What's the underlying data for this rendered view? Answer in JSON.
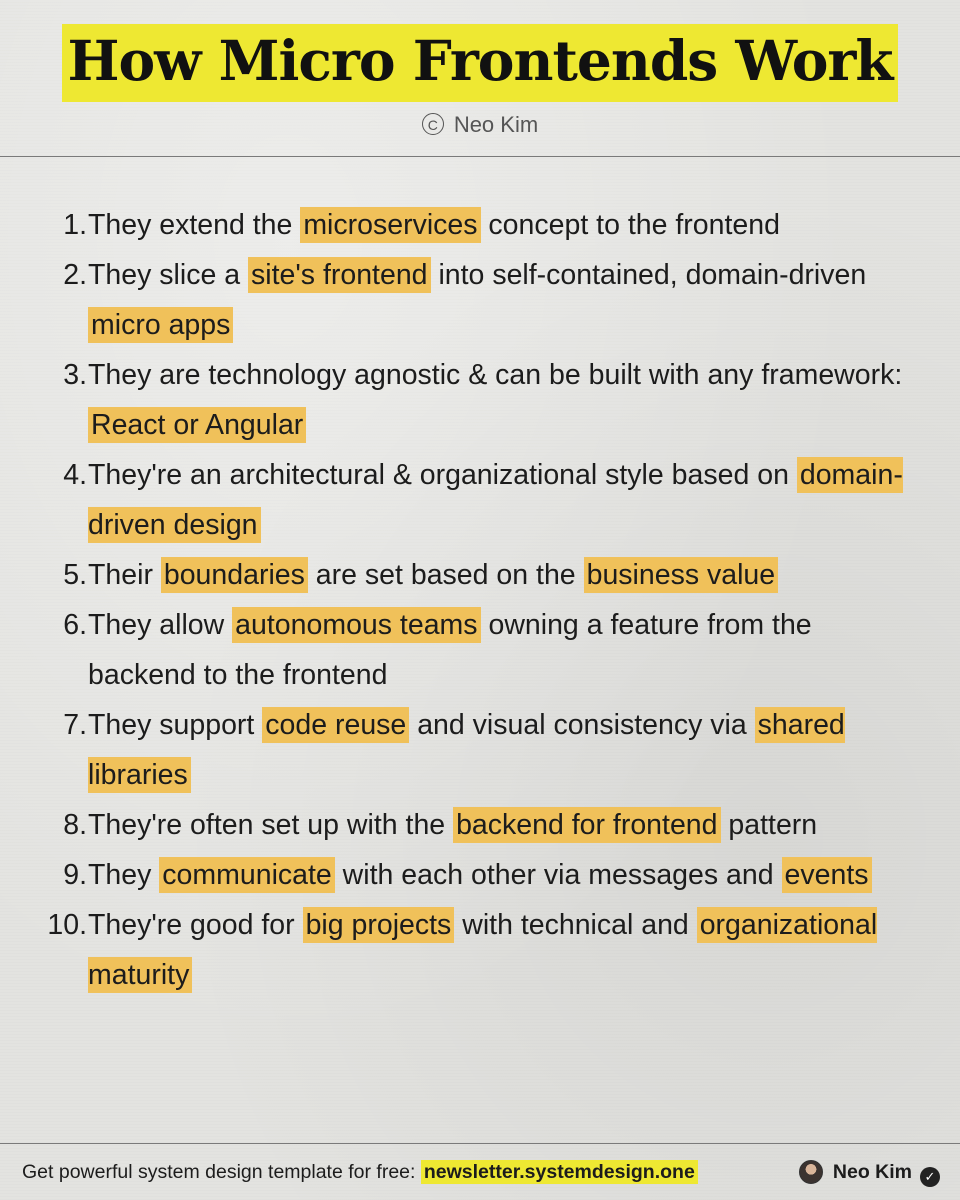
{
  "header": {
    "title": "How Micro Frontends Work",
    "copyright_symbol": "C",
    "author": "Neo Kim"
  },
  "items": [
    {
      "number": "1.",
      "segments": [
        {
          "text": "They extend the "
        },
        {
          "text": "microservices",
          "hl": true
        },
        {
          "text": " concept to the frontend"
        }
      ]
    },
    {
      "number": "2.",
      "segments": [
        {
          "text": "They slice a "
        },
        {
          "text": "site's frontend",
          "hl": true
        },
        {
          "text": " into self-contained, domain-driven "
        },
        {
          "text": "micro apps",
          "hl": true
        }
      ]
    },
    {
      "number": "3.",
      "segments": [
        {
          "text": "They are technology agnostic & can be built with any framework: "
        },
        {
          "text": "React or Angular",
          "hl": true
        }
      ]
    },
    {
      "number": "4.",
      "segments": [
        {
          "text": "They're an architectural & organizational style based on "
        },
        {
          "text": "domain-driven design",
          "hl": true
        }
      ]
    },
    {
      "number": "5.",
      "segments": [
        {
          "text": "Their "
        },
        {
          "text": "boundaries",
          "hl": true
        },
        {
          "text": " are set based on the "
        },
        {
          "text": "business value",
          "hl": true
        }
      ]
    },
    {
      "number": "6.",
      "segments": [
        {
          "text": "They allow "
        },
        {
          "text": "autonomous teams",
          "hl": true
        },
        {
          "text": " owning a feature from the backend to the frontend"
        }
      ]
    },
    {
      "number": "7.",
      "segments": [
        {
          "text": "They support "
        },
        {
          "text": "code reuse",
          "hl": true
        },
        {
          "text": " and visual consistency via "
        },
        {
          "text": "shared libraries",
          "hl": true
        }
      ]
    },
    {
      "number": "8.",
      "segments": [
        {
          "text": "They're often set up with the "
        },
        {
          "text": "backend for frontend",
          "hl": true
        },
        {
          "text": " pattern"
        }
      ]
    },
    {
      "number": "9.",
      "segments": [
        {
          "text": "They "
        },
        {
          "text": "communicate",
          "hl": true
        },
        {
          "text": " with each other via messages and "
        },
        {
          "text": "events",
          "hl": true
        }
      ]
    },
    {
      "number": "10.",
      "segments": [
        {
          "text": "They're good for "
        },
        {
          "text": "big projects",
          "hl": true
        },
        {
          "text": " with technical and "
        },
        {
          "text": "organizational maturity",
          "hl": true
        }
      ]
    }
  ],
  "footer": {
    "cta": "Get powerful system design template for free: ",
    "link": "newsletter.systemdesign.one",
    "brand_name": "Neo Kim",
    "avatar_icon": "avatar-photo",
    "verified_icon": "verified-check-icon"
  },
  "colors": {
    "title_highlight": "#eee832",
    "phrase_highlight": "#f0c15a",
    "background": "#e3e3e0"
  }
}
